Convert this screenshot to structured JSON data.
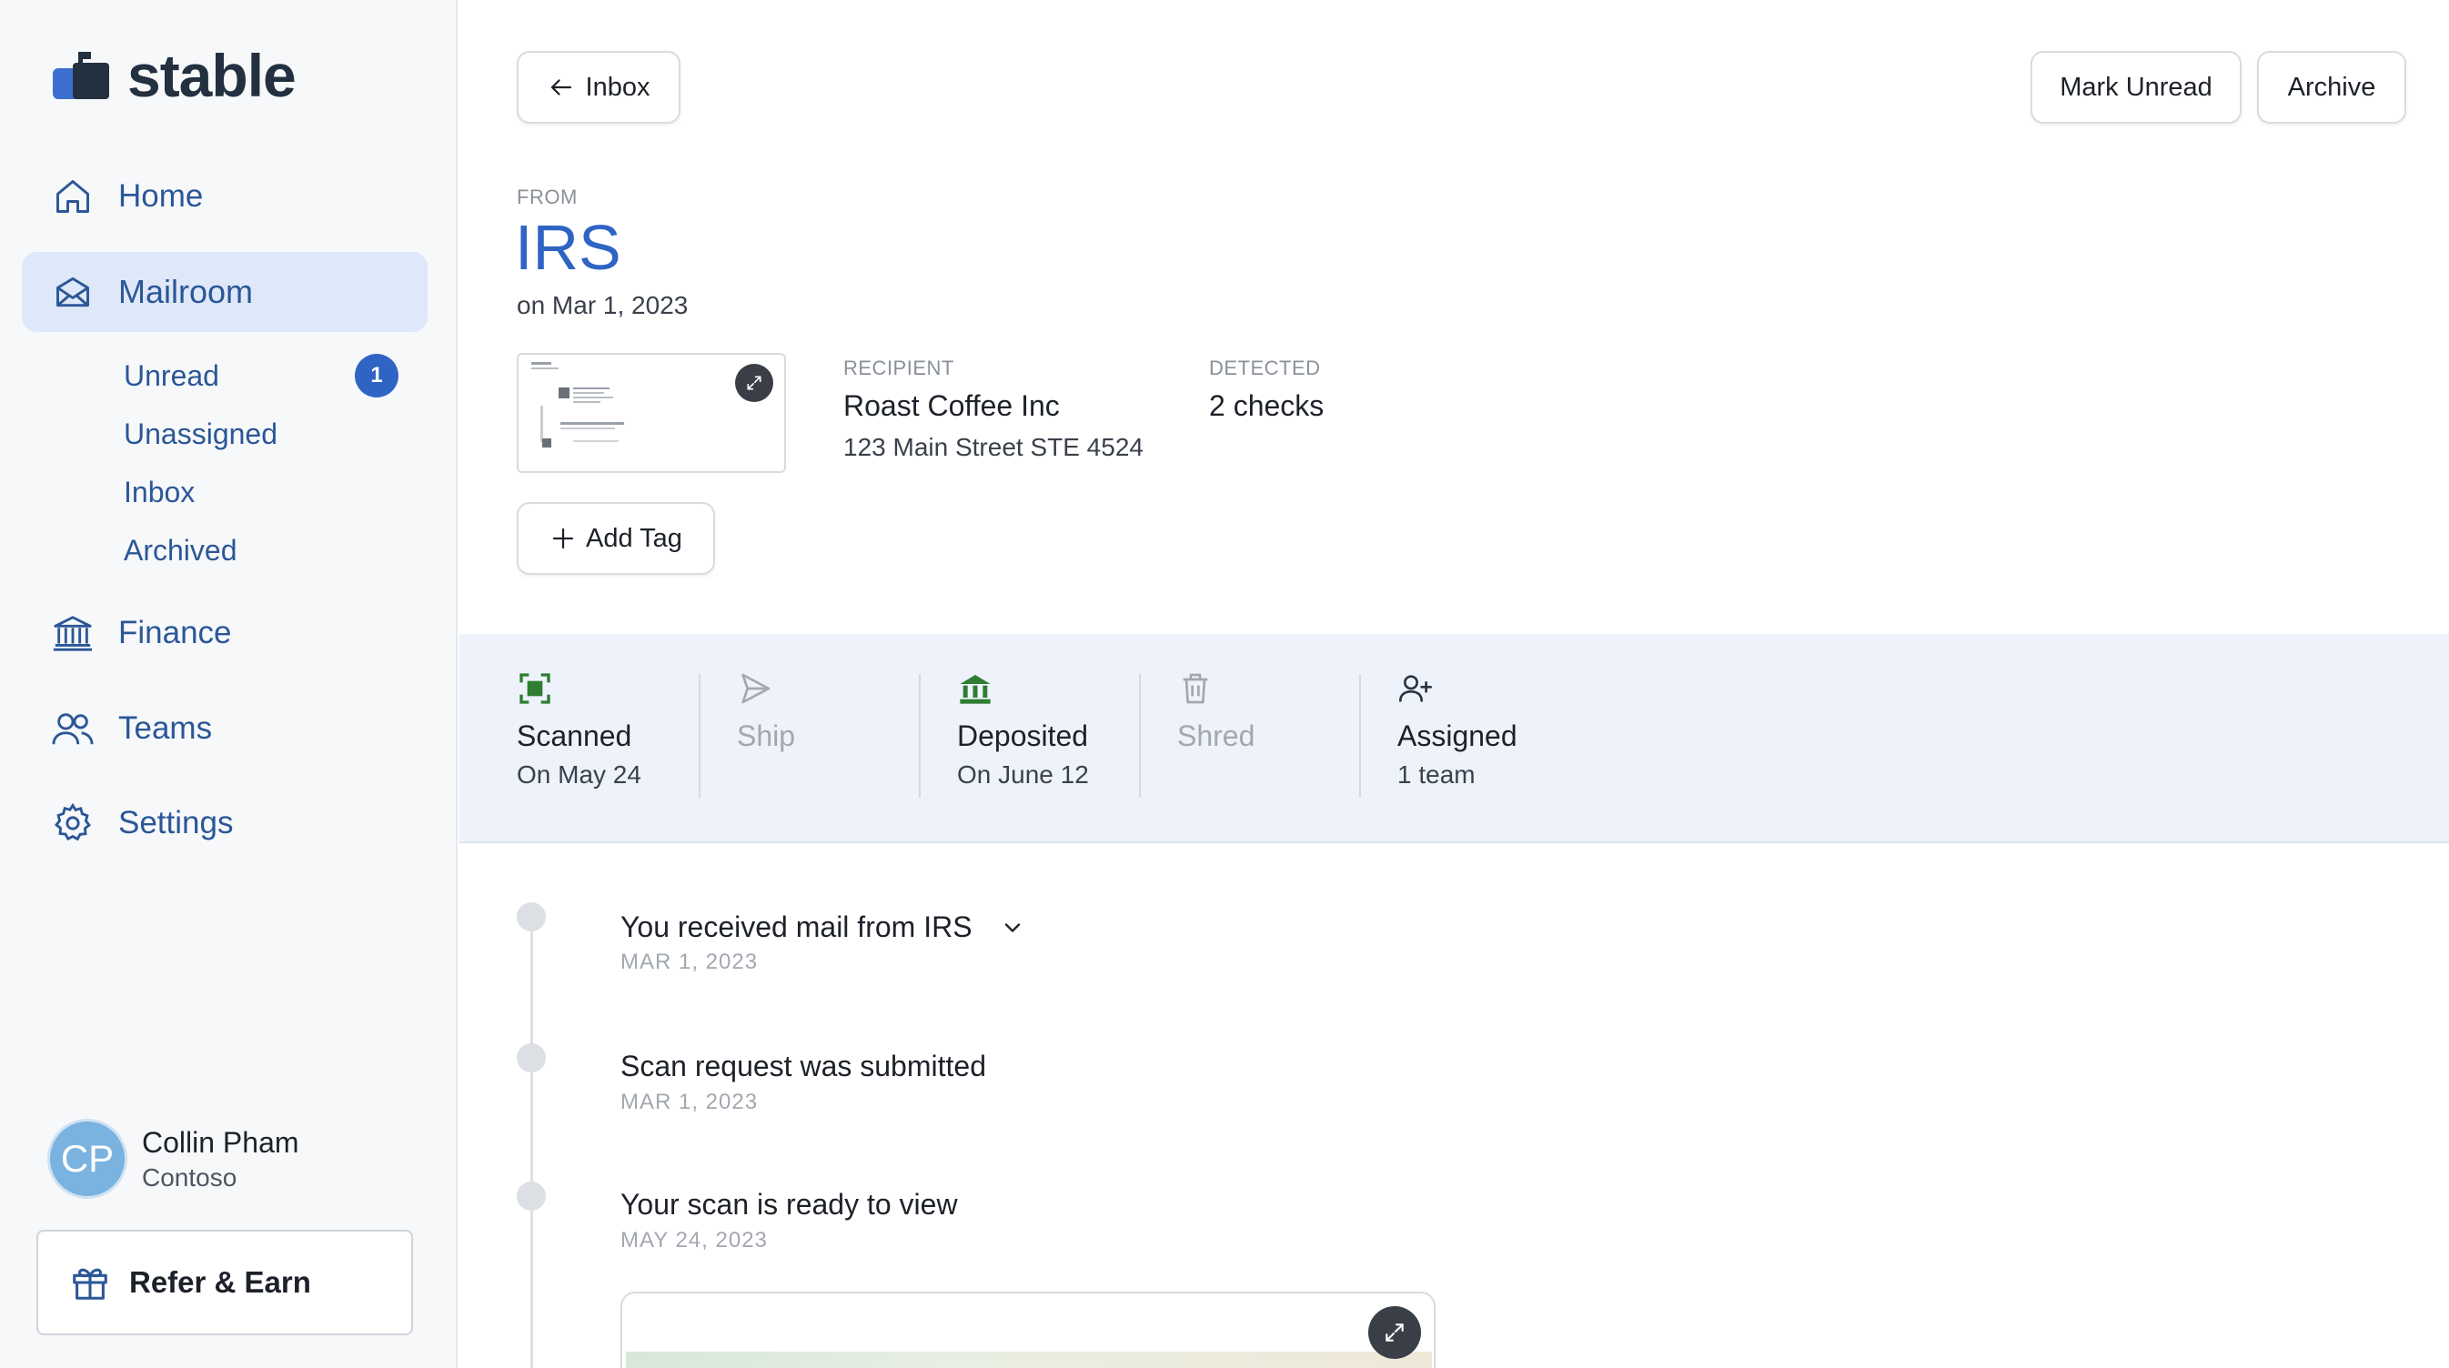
{
  "sidebar": {
    "logo_text": "stable",
    "nav": [
      {
        "label": "Home",
        "icon": "home-icon"
      },
      {
        "label": "Mailroom",
        "icon": "mail-open-icon"
      },
      {
        "label": "Finance",
        "icon": "bank-icon"
      },
      {
        "label": "Teams",
        "icon": "users-icon"
      },
      {
        "label": "Settings",
        "icon": "gear-icon"
      }
    ],
    "mailroom_sub": [
      {
        "label": "Unread",
        "badge": "1"
      },
      {
        "label": "Unassigned"
      },
      {
        "label": "Inbox"
      },
      {
        "label": "Archived"
      }
    ],
    "user": {
      "initials": "CP",
      "name": "Collin Pham",
      "org": "Contoso"
    },
    "refer_label": "Refer & Earn"
  },
  "header": {
    "back_label": "Inbox",
    "mark_unread_label": "Mark Unread",
    "archive_label": "Archive"
  },
  "mail": {
    "from_label": "FROM",
    "from_name": "IRS",
    "date": "on Mar 1, 2023",
    "recipient_label": "RECIPIENT",
    "recipient_name": "Roast Coffee Inc",
    "recipient_address": "123 Main Street STE 4524",
    "detected_label": "DETECTED",
    "detected_value": "2 checks",
    "add_tag_label": "Add Tag"
  },
  "steps": [
    {
      "title": "Scanned",
      "sub": "On May 24",
      "icon": "scan-icon",
      "active": true
    },
    {
      "title": "Ship",
      "sub": "",
      "icon": "send-icon",
      "active": false
    },
    {
      "title": "Deposited",
      "sub": "On June 12",
      "icon": "bank-icon",
      "active": true
    },
    {
      "title": "Shred",
      "sub": "",
      "icon": "trash-icon",
      "active": false
    },
    {
      "title": "Assigned",
      "sub": "1 team",
      "icon": "user-plus-icon",
      "active": true
    }
  ],
  "timeline": [
    {
      "title": "You received mail from IRS",
      "date": "MAR 1, 2023",
      "expandable": true
    },
    {
      "title": "Scan request was submitted",
      "date": "MAR 1, 2023"
    },
    {
      "title": "Your scan is ready to view",
      "date": "MAY 24, 2023"
    }
  ],
  "colors": {
    "accent": "#2f64c4",
    "step_green": "#2e7d32",
    "active_nav_bg": "#dfe8f8"
  }
}
